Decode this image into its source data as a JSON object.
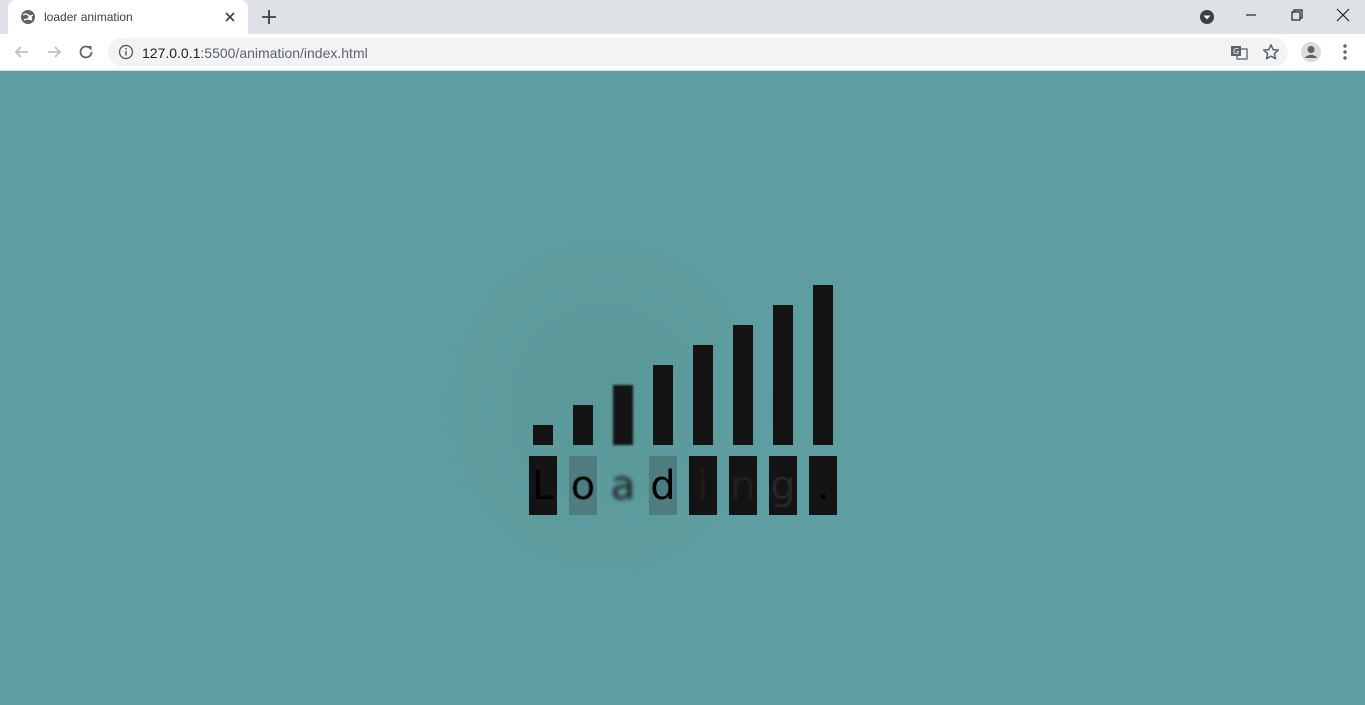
{
  "browser": {
    "tab_title": "loader animation",
    "url_host": "127.0.0.1",
    "url_rest": ":5500/animation/index.html"
  },
  "loader": {
    "bar_count": 8,
    "letters": [
      {
        "char": "L",
        "state": "solid"
      },
      {
        "char": "o",
        "state": "faded"
      },
      {
        "char": "a",
        "state": "blurred"
      },
      {
        "char": "d",
        "state": "faded"
      },
      {
        "char": "i",
        "state": "hidden"
      },
      {
        "char": "n",
        "state": "hidden"
      },
      {
        "char": "g",
        "state": "dim"
      },
      {
        "char": ".",
        "state": "solid"
      }
    ]
  },
  "colors": {
    "background": "#5f9ea0",
    "bar": "#141414",
    "faded_box": "#4f7c7e"
  }
}
